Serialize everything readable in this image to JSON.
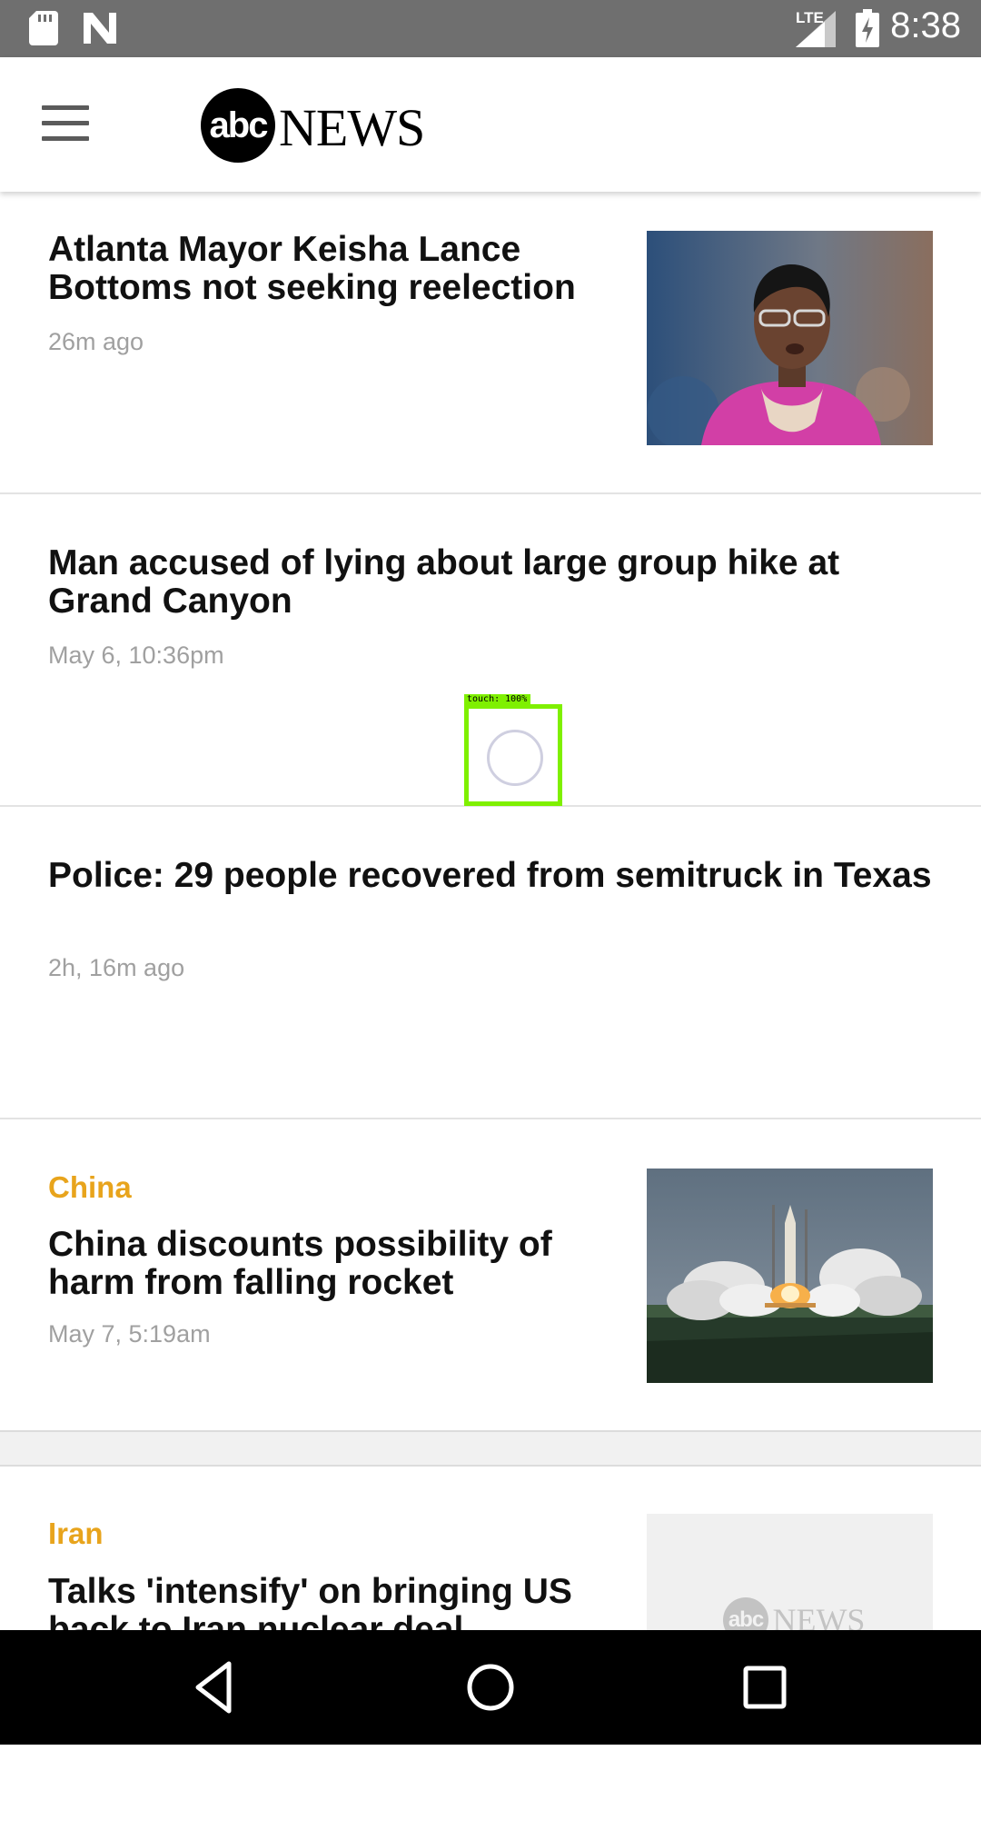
{
  "status_bar": {
    "time": "8:38",
    "network": "LTE",
    "icons": [
      "sd-card-icon",
      "n-notification-icon",
      "signal-icon",
      "battery-charging-icon"
    ]
  },
  "app_bar": {
    "menu_icon": "hamburger-menu-icon",
    "logo_mark": "abc",
    "logo_text": "NEWS"
  },
  "articles": [
    {
      "category": "",
      "headline": "Atlanta Mayor Keisha Lance Bottoms not seeking reelection",
      "timestamp": "26m ago",
      "thumbnail": "photo-of-woman-in-pink-jacket"
    },
    {
      "category": "",
      "headline": "Man accused of lying about large group hike at Grand Canyon",
      "timestamp": "May 6, 10:36pm",
      "thumbnail": ""
    },
    {
      "category": "",
      "headline": "Police: 29 people recovered from semitruck in Texas",
      "timestamp": "2h, 16m ago",
      "thumbnail": ""
    },
    {
      "category": "China",
      "headline": "China discounts possibility of harm from falling rocket",
      "timestamp": "May 7, 5:19am",
      "thumbnail": "rocket-launch-photo"
    },
    {
      "category": "Iran",
      "headline": "Talks 'intensify' on bringing US back to Iran nuclear deal",
      "timestamp": "",
      "thumbnail": "abc-news-placeholder",
      "placeholder_logo_mark": "abc",
      "placeholder_logo_text": "NEWS"
    }
  ],
  "touch_indicator": {
    "label": "touch: 100%"
  },
  "nav_bar": {
    "buttons": [
      "back-icon",
      "home-icon",
      "recents-icon"
    ]
  },
  "colors": {
    "status_bar": "#6f6f6f",
    "category": "#e8a41c",
    "touch_highlight": "#7ff000",
    "nav_bar": "#000000"
  }
}
